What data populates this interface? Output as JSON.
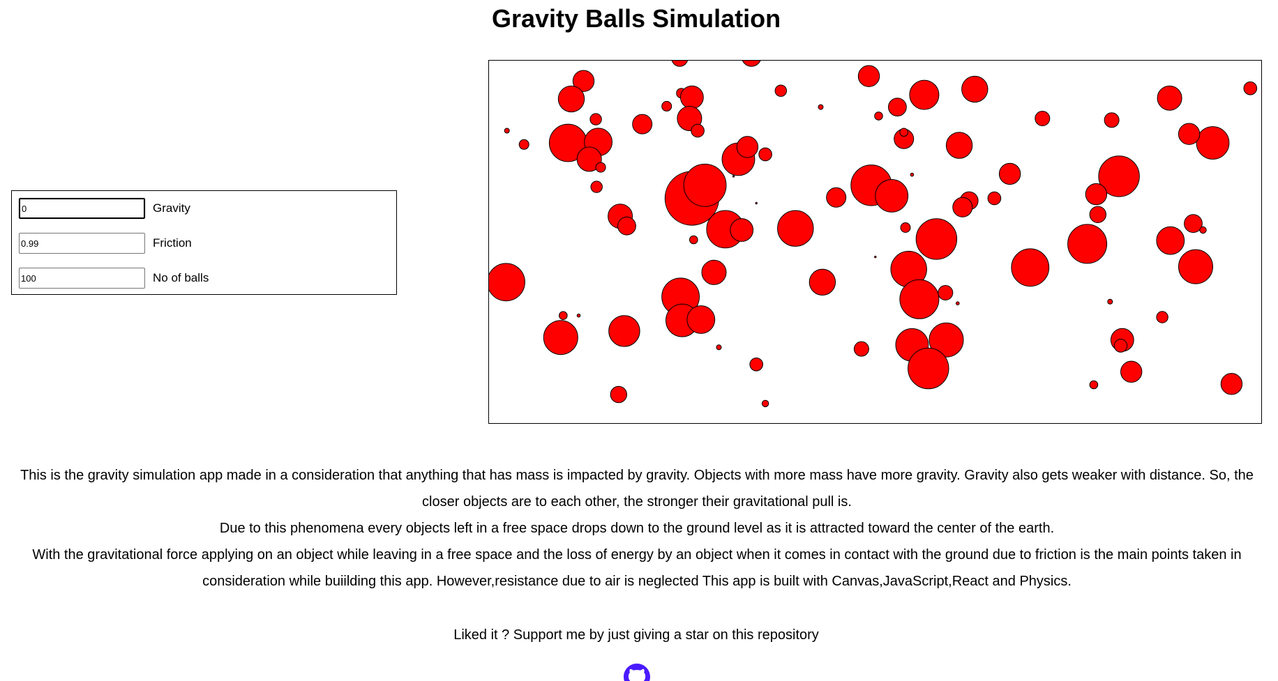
{
  "page": {
    "title": "Gravity Balls Simulation"
  },
  "controls": {
    "gravity": {
      "value": "0",
      "label": "Gravity"
    },
    "friction": {
      "value": "0.99",
      "label": "Friction"
    },
    "balls": {
      "value": "100",
      "label": "No of balls"
    }
  },
  "simulation": {
    "ball_fill": "#ff0000",
    "ball_stroke": "#000000",
    "balls": [
      [
        1314,
        28
      ],
      [
        1330,
        206,
        5
      ],
      [
        1334,
        154,
        25
      ],
      [
        1336,
        164,
        19
      ],
      [
        1254,
        128,
        11
      ],
      [
        1231,
        42,
        17
      ],
      [
        1249,
        42,
        8
      ],
      [
        1262,
        44,
        7
      ],
      [
        1343,
        208,
        5
      ],
      [
        1430,
        95,
        6
      ],
      [
        1332,
        164,
        5
      ],
      [
        1352,
        153,
        6
      ],
      [
        1415,
        144,
        7
      ],
      [
        1435,
        161,
        5
      ],
      [
        1341,
        204,
        8
      ],
      [
        27,
        100,
        5
      ],
      [
        51,
        122,
        6
      ],
      [
        105,
        120,
        20
      ],
      [
        125,
        123,
        17
      ],
      [
        134,
        144,
        8
      ],
      [
        146,
        138,
        15
      ],
      [
        176,
        94,
        8
      ],
      [
        134,
        157,
        18
      ],
      [
        154,
        162,
        15
      ],
      [
        176,
        84,
        6
      ],
      [
        203,
        87,
        15
      ],
      [
        188,
        190,
        14
      ],
      [
        197,
        202,
        14
      ],
      [
        253,
        228,
        6
      ],
      [
        228,
        150,
        34
      ],
      [
        219,
        127,
        27
      ],
      [
        249,
        207,
        12
      ],
      [
        263,
        208,
        10
      ]
    ],
    "balls_full": [
      [
        845,
        1,
        14
      ],
      [
        924,
        -4,
        14
      ],
      [
        1095,
        3,
        10
      ],
      [
        1083,
        54,
        8
      ],
      [
        1068,
        32,
        21
      ],
      [
        969,
        68,
        23
      ],
      [
        1011,
        62,
        11
      ],
      [
        1146,
        136,
        24
      ],
      [
        1087,
        38,
        17
      ]
    ],
    "circles": [
      [
        834,
        -3,
        10
      ],
      [
        922,
        -5,
        12
      ],
      [
        1534,
        34,
        8
      ],
      [
        1435,
        46,
        15
      ],
      [
        1364,
        73,
        9
      ],
      [
        1279,
        71,
        9
      ],
      [
        1196,
        35,
        16
      ],
      [
        1134,
        42,
        18
      ],
      [
        1101,
        57,
        11
      ],
      [
        1066,
        19,
        13
      ],
      [
        1078,
        68,
        5
      ],
      [
        1007,
        57,
        3
      ],
      [
        958,
        37,
        7
      ],
      [
        716,
        25,
        13
      ],
      [
        701,
        47,
        16
      ],
      [
        836,
        40,
        6
      ],
      [
        849,
        45,
        14
      ],
      [
        818,
        56,
        6
      ],
      [
        846,
        71,
        15
      ],
      [
        856,
        86,
        8
      ],
      [
        788,
        78,
        12
      ],
      [
        731,
        72,
        7
      ],
      [
        622,
        86,
        3
      ],
      [
        643,
        103,
        6
      ],
      [
        697,
        101,
        23
      ],
      [
        734,
        100,
        17
      ],
      [
        723,
        121,
        15
      ],
      [
        737,
        131,
        6
      ],
      [
        732,
        155,
        7
      ],
      [
        1488,
        101,
        20
      ],
      [
        1459,
        90,
        13
      ],
      [
        1373,
        142,
        25
      ],
      [
        1345,
        164,
        13
      ],
      [
        1334,
        225,
        24
      ],
      [
        1436,
        221,
        17
      ],
      [
        1464,
        200,
        11
      ],
      [
        1476,
        208,
        4
      ],
      [
        1467,
        253,
        21
      ],
      [
        1239,
        139,
        13
      ],
      [
        1220,
        169,
        8
      ],
      [
        1189,
        172,
        11
      ],
      [
        1181,
        180,
        12
      ],
      [
        1177,
        104,
        16
      ],
      [
        1109,
        96,
        12
      ],
      [
        1109,
        88,
        5
      ],
      [
        1119,
        140,
        2
      ],
      [
        1069,
        153,
        25
      ],
      [
        1094,
        166,
        20
      ],
      [
        1026,
        168,
        12
      ],
      [
        976,
        206,
        22
      ],
      [
        1111,
        205,
        6
      ],
      [
        1149,
        219,
        25
      ],
      [
        1264,
        254,
        23
      ],
      [
        1347,
        189,
        10
      ],
      [
        906,
        121,
        20
      ],
      [
        917,
        106,
        13
      ],
      [
        939,
        115,
        8
      ],
      [
        900,
        142,
        1
      ],
      [
        849,
        169,
        33
      ],
      [
        865,
        153,
        26
      ],
      [
        928,
        175,
        1
      ],
      [
        890,
        207,
        23
      ],
      [
        910,
        208,
        14
      ],
      [
        851,
        220,
        5
      ],
      [
        761,
        191,
        15
      ],
      [
        769,
        203,
        11
      ],
      [
        876,
        260,
        15
      ],
      [
        1009,
        272,
        16
      ],
      [
        1115,
        256,
        22
      ],
      [
        1128,
        293,
        24
      ],
      [
        1160,
        285,
        9
      ],
      [
        1175,
        298,
        2
      ],
      [
        1074,
        241,
        1
      ],
      [
        621,
        272,
        23
      ],
      [
        691,
        313,
        5
      ],
      [
        710,
        313,
        2
      ],
      [
        688,
        340,
        21
      ],
      [
        766,
        332,
        19
      ],
      [
        835,
        290,
        23
      ],
      [
        837,
        319,
        20
      ],
      [
        860,
        318,
        17
      ],
      [
        882,
        352,
        3
      ],
      [
        928,
        373,
        8
      ],
      [
        939,
        421,
        4
      ],
      [
        759,
        410,
        10
      ],
      [
        1057,
        354,
        9
      ],
      [
        1119,
        349,
        20
      ],
      [
        1161,
        343,
        21
      ],
      [
        1139,
        378,
        25
      ],
      [
        1362,
        296,
        3
      ],
      [
        1426,
        315,
        7
      ],
      [
        1377,
        343,
        14
      ],
      [
        1375,
        350,
        8
      ],
      [
        1388,
        382,
        13
      ],
      [
        1342,
        398,
        5
      ],
      [
        1511,
        397,
        13
      ]
    ]
  },
  "description": {
    "line1": "This is the gravity simulation app made in a consideration that anything that has mass is impacted by gravity. Objects with more mass have more gravity. Gravity also gets weaker with distance. So, the closer objects are to each other, the stronger their gravitational pull is.",
    "line2": "Due to this phenomena every objects left in a free space drops down to the ground level as it is attracted toward the center of the earth.",
    "line3": "With the gravitational force applying on an object while leaving in a free space and the loss of energy by an object when it comes in contact with the ground due to friction is the main points taken in consideration while buiilding this app. However,resistance due to air is neglected This app is built with Canvas,JavaScript,React and Physics."
  },
  "support": {
    "text": "Liked it ? Support me by just giving a star on this repository"
  },
  "icons": {
    "github": "github-icon",
    "github_color": "#4a1aff"
  }
}
